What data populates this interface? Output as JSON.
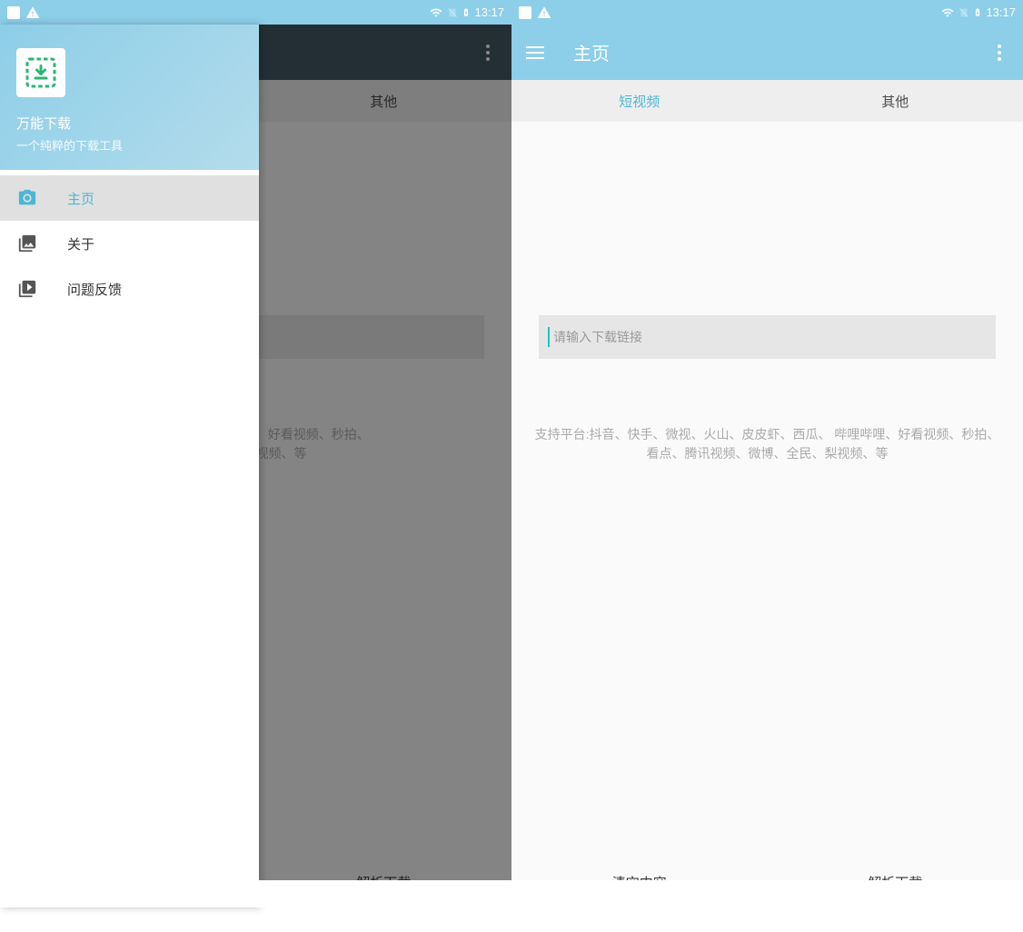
{
  "status": {
    "time": "13:17"
  },
  "left": {
    "tabs": {
      "other": "其他"
    },
    "support_text": "F、西瓜、 哔哩哔哩、好看视频、秒拍、\n全民、梨视频、等",
    "bottom": {
      "parse": "解析下载"
    },
    "drawer": {
      "app_name": "万能下载",
      "app_subtitle": "一个纯粹的下载工具",
      "items": [
        {
          "label": "主页"
        },
        {
          "label": "关于"
        },
        {
          "label": "问题反馈"
        }
      ]
    }
  },
  "right": {
    "toolbar_title": "主页",
    "tabs": {
      "short_video": "短视频",
      "other": "其他"
    },
    "input_placeholder": "请输入下载链接",
    "support_text": "支持平台:抖音、快手、微视、火山、皮皮虾、西瓜、 哔哩哔哩、好看视频、秒拍、看点、腾讯视频、微博、全民、梨视频、等",
    "bottom": {
      "clear": "清空内容",
      "parse": "解析下载"
    }
  }
}
